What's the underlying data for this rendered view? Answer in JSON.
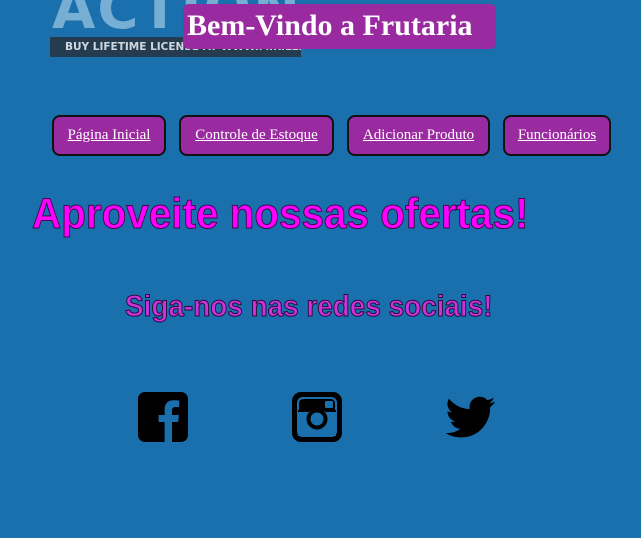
{
  "watermark": {
    "logo_text": "ACTION!",
    "license_text": "BUY LIFETIME LICENSE AT WWW.MIRILLIS.COM"
  },
  "header": {
    "title": "Bem-Vindo a Frutaria"
  },
  "nav": {
    "items": [
      {
        "label": "Página Inicial"
      },
      {
        "label": "Controle de Estoque"
      },
      {
        "label": "Adicionar Produto"
      },
      {
        "label": "Funcionários"
      }
    ]
  },
  "main": {
    "offers_heading": "Aproveite nossas ofertas!",
    "social_heading": "Siga-nos nas redes sociais!"
  },
  "social": {
    "icons": [
      "facebook-icon",
      "instagram-icon",
      "twitter-icon"
    ]
  },
  "colors": {
    "background": "#1a6fad",
    "button": "#9a2a9f",
    "offers_text": "#ff00ff",
    "social_text": "#cc33dd"
  }
}
